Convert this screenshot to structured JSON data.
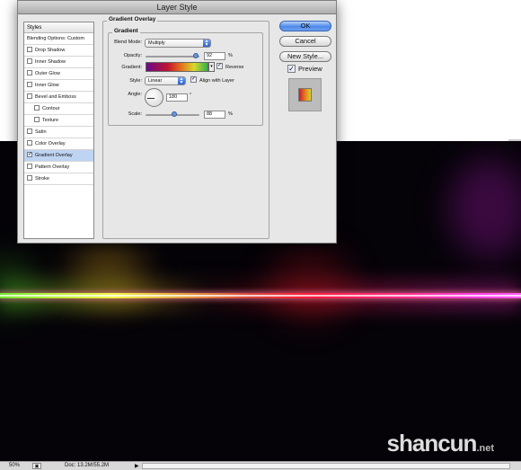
{
  "dialog": {
    "title": "Layer Style",
    "styles_list": {
      "header": "Styles",
      "items": [
        {
          "label": "Blending Options: Custom",
          "checkbox": false,
          "checked": false,
          "indent": false,
          "selected": false
        },
        {
          "label": "Drop Shadow",
          "checkbox": true,
          "checked": false,
          "indent": false,
          "selected": false
        },
        {
          "label": "Inner Shadow",
          "checkbox": true,
          "checked": false,
          "indent": false,
          "selected": false
        },
        {
          "label": "Outer Glow",
          "checkbox": true,
          "checked": false,
          "indent": false,
          "selected": false
        },
        {
          "label": "Inner Glow",
          "checkbox": true,
          "checked": false,
          "indent": false,
          "selected": false
        },
        {
          "label": "Bevel and Emboss",
          "checkbox": true,
          "checked": false,
          "indent": false,
          "selected": false
        },
        {
          "label": "Contour",
          "checkbox": true,
          "checked": false,
          "indent": true,
          "selected": false
        },
        {
          "label": "Texture",
          "checkbox": true,
          "checked": false,
          "indent": true,
          "selected": false
        },
        {
          "label": "Satin",
          "checkbox": true,
          "checked": false,
          "indent": false,
          "selected": false
        },
        {
          "label": "Color Overlay",
          "checkbox": true,
          "checked": false,
          "indent": false,
          "selected": false
        },
        {
          "label": "Gradient Overlay",
          "checkbox": true,
          "checked": true,
          "indent": false,
          "selected": true
        },
        {
          "label": "Pattern Overlay",
          "checkbox": true,
          "checked": false,
          "indent": false,
          "selected": false
        },
        {
          "label": "Stroke",
          "checkbox": true,
          "checked": false,
          "indent": false,
          "selected": false
        }
      ]
    },
    "gradient_overlay": {
      "panel_title": "Gradient Overlay",
      "group_title": "Gradient",
      "blend_mode_label": "Blend Mode:",
      "blend_mode_value": "Multiply",
      "opacity_label": "Opacity:",
      "opacity_value": "92",
      "opacity_unit": "%",
      "gradient_label": "Gradient:",
      "reverse_label": "Reverse",
      "reverse_checked": true,
      "style_label": "Style:",
      "style_value": "Linear",
      "align_label": "Align with Layer",
      "align_checked": true,
      "angle_label": "Angle:",
      "angle_value": "180",
      "angle_unit": "°",
      "scale_label": "Scale:",
      "scale_value": "88",
      "scale_unit": "%"
    },
    "buttons": {
      "ok": "OK",
      "cancel": "Cancel",
      "new_style": "New Style..."
    },
    "preview": {
      "label": "Preview",
      "checked": true
    }
  },
  "status_bar": {
    "zoom": "50%",
    "doc": "Doc: 13.2M/55.2M"
  },
  "watermark": {
    "text": "shancun",
    "suffix": ".net"
  },
  "colors": {
    "ok_button": "#4e8ae9",
    "selected_row": "#bfd3f2",
    "canvas_bg": "#050308"
  }
}
